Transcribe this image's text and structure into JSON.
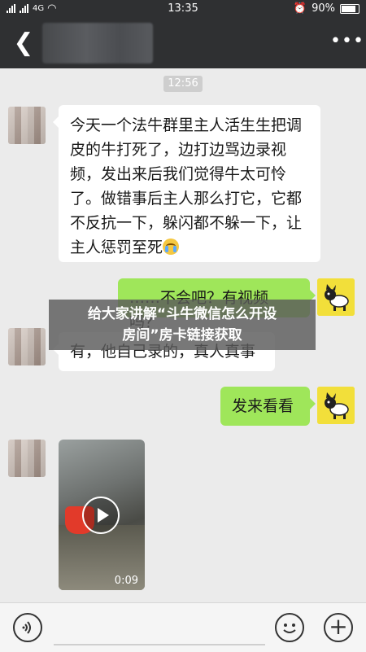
{
  "status_bar": {
    "carrier_label": "4G",
    "time": "13:35",
    "battery": "90%"
  },
  "header": {
    "back_icon": "chevron-left-icon",
    "more_icon": "more-dots-icon"
  },
  "chat": {
    "timestamp": "12:56",
    "messages": [
      {
        "side": "in",
        "text": "今天一个法牛群里主人活生生把调皮的牛打死了，边打边骂边录视频，发出来后我们觉得牛太可怜了。做错事后主人那么打它，它都不反抗一下，躲闪都不躲一下，让主人惩罚至死",
        "emoji": "crying-face-emoji"
      },
      {
        "side": "out",
        "text": "……不会吧？有视频吗？"
      },
      {
        "side": "in",
        "text": "有，他自己录的，真人真事"
      },
      {
        "side": "out",
        "text": "发来看看"
      },
      {
        "side": "in",
        "type": "video",
        "duration": "0:09"
      }
    ]
  },
  "overlay": {
    "line1": "给大家讲解“斗牛微信怎么开设",
    "line2": "房间”房卡链接获取"
  },
  "input_bar": {
    "voice_icon": "voice-icon",
    "emoji_icon": "emoji-icon",
    "plus_icon": "plus-icon"
  }
}
